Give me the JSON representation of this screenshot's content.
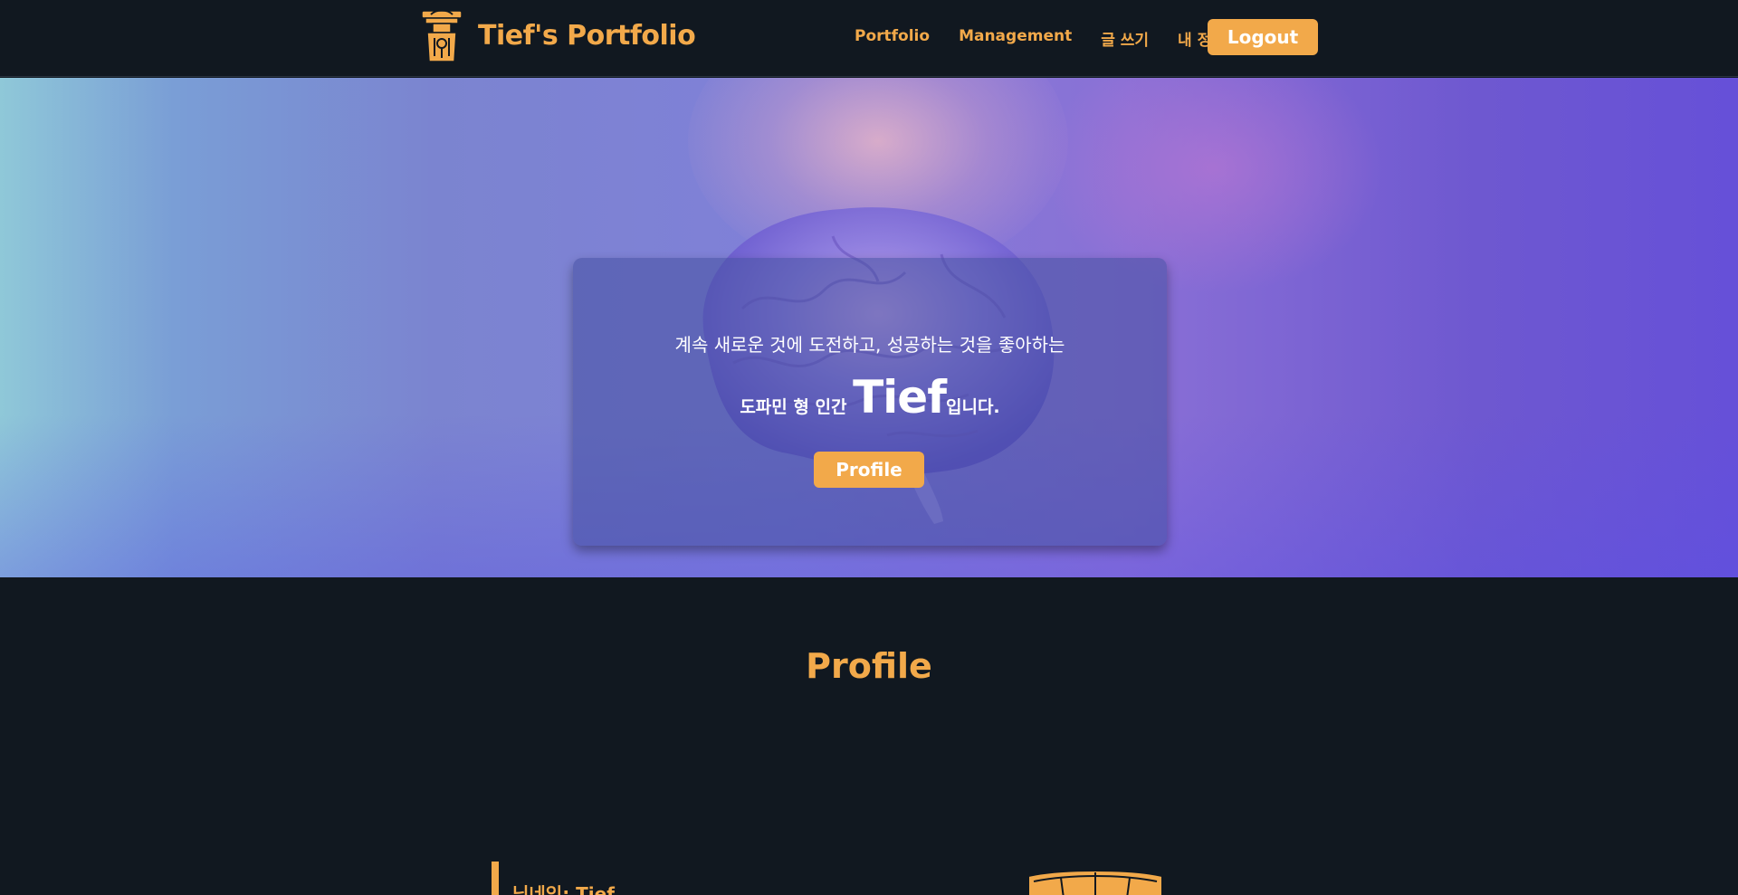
{
  "header": {
    "brand": "Tief's Portfolio",
    "nav": [
      "Portfolio",
      "Management",
      "글 쓰기",
      "내 정보"
    ],
    "logout_label": "Logout"
  },
  "hero": {
    "line1": "계속 새로운 것에 도전하고, 성공하는 것을 좋아하는",
    "line2_prefix": "도파민 형 인간 ",
    "line2_name": "Tief",
    "line2_suffix": "입니다.",
    "button_label": "Profile"
  },
  "profile": {
    "title": "Profile",
    "nickname": "닉네임: Tief"
  },
  "colors": {
    "accent": "#f2a94a",
    "background": "#111820"
  }
}
